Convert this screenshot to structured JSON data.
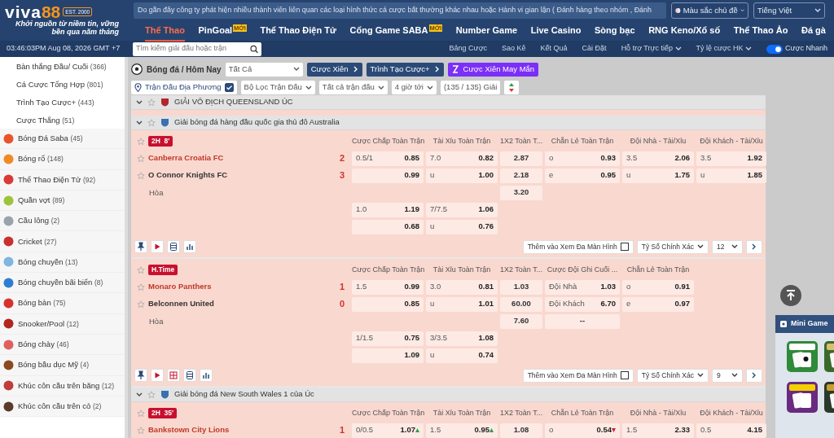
{
  "header": {
    "logo_name": "viva",
    "logo_number": "88",
    "logo_badge": "EST. 2000",
    "slogan": "Khởi nguồn từ niềm tin, vững bền qua năm tháng",
    "notice": "Do gần đây công ty phát hiện nhiều thành viên liên quan các loại hình thức cá cược bất thường khác nhau hoặc Hành vi gian lận ( Đánh hàng theo nhóm , Đánh",
    "theme_select": "Màu sắc chủ đề",
    "language": "Tiếng Việt"
  },
  "nav": [
    {
      "label": "Thể Thao",
      "selected": true
    },
    {
      "label": "PinGoal",
      "badge": "MỚI",
      "selected": false
    },
    {
      "label": "Thể Thao Điện Tử",
      "selected": false
    },
    {
      "label": "Cổng Game SABA",
      "badge": "MỚI",
      "selected": false
    },
    {
      "label": "Number Game",
      "selected": false
    },
    {
      "label": "Live Casino",
      "selected": false
    },
    {
      "label": "Sòng bạc",
      "selected": false
    },
    {
      "label": "RNG Keno/Xổ số",
      "selected": false
    },
    {
      "label": "Thể Thao Ảo",
      "selected": false
    },
    {
      "label": "Đá gà",
      "selected": false
    }
  ],
  "subbar": {
    "clock": "03:46:03PM Aug 08, 2026 GMT +7",
    "search": {
      "placeholder": "Tìm kiếm giải đấu hoặc trận"
    },
    "links": [
      {
        "label": "Bảng Cược",
        "dropdown": false
      },
      {
        "label": "Sao Kê",
        "dropdown": false
      },
      {
        "label": "Kết Quả",
        "dropdown": false
      },
      {
        "label": "Cài Đặt",
        "dropdown": false
      },
      {
        "label": "Hỗ trợ Trực tiếp",
        "dropdown": true
      },
      {
        "label": "Tỷ lệ cược HK",
        "dropdown": true
      }
    ],
    "quick_bet": {
      "label": "Cược Nhanh",
      "on": true
    }
  },
  "sidebar": {
    "bet_types": [
      {
        "label": "Bàn thắng Đầu/ Cuối",
        "count": "(366)"
      },
      {
        "label": "Cá Cược Tổng Hợp",
        "count": "(801)"
      },
      {
        "label": "Trình Tạo Cược+",
        "count": "(443)"
      },
      {
        "label": "Cược Thắng",
        "count": "(51)"
      }
    ],
    "sports": [
      {
        "label": "Bóng Đá Saba",
        "count": "(45)",
        "color": "#e8542c"
      },
      {
        "label": "Bóng rổ",
        "count": "(148)",
        "color": "#f08a24"
      },
      {
        "label": "Thể Thao Điện Tử",
        "count": "(92)",
        "color": "#d93a3a"
      },
      {
        "label": "Quần vợt",
        "count": "(89)",
        "color": "#9cc43a"
      },
      {
        "label": "Cầu lông",
        "count": "(2)",
        "color": "#9aa3ad"
      },
      {
        "label": "Cricket",
        "count": "(27)",
        "color": "#c8312f"
      },
      {
        "label": "Bóng chuyền",
        "count": "(13)",
        "color": "#7fb5e0"
      },
      {
        "label": "Bóng chuyền bãi biển",
        "count": "(8)",
        "color": "#2f7fd0"
      },
      {
        "label": "Bóng bàn",
        "count": "(75)",
        "color": "#d6332f"
      },
      {
        "label": "Snooker/Pool",
        "count": "(12)",
        "color": "#b3261e"
      },
      {
        "label": "Bóng chày",
        "count": "(46)",
        "color": "#e06060"
      },
      {
        "label": "Bóng bầu dục Mỹ",
        "count": "(4)",
        "color": "#8a4a1e"
      },
      {
        "label": "Khúc côn cầu trên băng",
        "count": "(12)",
        "color": "#c23b3b"
      },
      {
        "label": "Khúc côn cầu trên cỏ",
        "count": "(2)",
        "color": "#5a3a2a"
      }
    ]
  },
  "toolbar": {
    "title": "Bóng đá / Hôm Nay",
    "filter": "Tất Cả",
    "buttons": [
      {
        "label": "Cược Xiên",
        "kind": "arrow"
      },
      {
        "label": "Trình Tạo Cược+",
        "kind": "arrow"
      },
      {
        "label": "Cược Xiên May Mắn",
        "kind": "lucky"
      }
    ]
  },
  "filters": [
    {
      "label": "Trận Đấu Địa Phương",
      "kind": "check",
      "checked": true
    },
    {
      "label": "Bộ Lọc Trận Đấu",
      "kind": "dropdown"
    },
    {
      "label": "Tất cả trận đấu",
      "kind": "dropdown"
    },
    {
      "label": "4 giờ tới",
      "kind": "dropdown"
    },
    {
      "label": "(135 / 135) Giải",
      "kind": "plain"
    },
    {
      "kind": "sort"
    }
  ],
  "leagues": [
    {
      "name": "GIẢI VÔ ĐỊCH QUEENSLAND ÚC"
    },
    {
      "name": "Giải bóng đá hàng đầu quốc gia thủ đô Australia",
      "matches": [
        {
          "status": "2H  8'",
          "columns": [
            "Cược Chấp Toàn Trận",
            "Tài Xỉu Toàn Trận",
            "1X2 Toàn T...",
            "Chẵn Lẻ Toàn Trận",
            "Đội Nhà - Tài/Xỉu",
            "Đội Khách - Tài/Xỉu"
          ],
          "teams": [
            {
              "name": "Canberra Croatia FC",
              "score": "2",
              "favorite": true
            },
            {
              "name": "O Connor Knights FC",
              "score": "3",
              "favorite": false
            }
          ],
          "draw_label": "Hòa",
          "rows": [
            [
              {
                "line": "0.5/1",
                "odds": "0.85"
              },
              {
                "line": "7.0",
                "odds": "0.82"
              },
              {
                "text": "2.87"
              },
              {
                "line": "o",
                "odds": "0.93"
              },
              {
                "line": "3.5",
                "odds": "2.06"
              },
              {
                "line": "3.5",
                "odds": "1.92"
              }
            ],
            [
              {
                "odds": "0.99"
              },
              {
                "line": "u",
                "odds": "1.00"
              },
              {
                "text": "2.18"
              },
              {
                "line": "e",
                "odds": "0.95"
              },
              {
                "line": "u",
                "odds": "1.75"
              },
              {
                "line": "u",
                "odds": "1.85"
              }
            ],
            [
              null,
              null,
              {
                "text": "3.20"
              },
              null,
              null,
              null
            ],
            [
              {
                "line": "1.0",
                "odds": "1.19"
              },
              {
                "line": "7/7.5",
                "odds": "1.06"
              },
              null,
              null,
              null,
              null
            ],
            [
              {
                "odds": "0.68"
              },
              {
                "line": "u",
                "odds": "0.76"
              },
              null,
              null,
              null,
              null
            ]
          ],
          "tools": [
            {
              "kind": "pin"
            },
            {
              "kind": "play"
            },
            {
              "kind": "list"
            },
            {
              "kind": "chart"
            }
          ],
          "multi_view": {
            "label": "Thêm vào Xem Đa Màn Hình",
            "checked": false
          },
          "market_select": "Tỷ Số Chính Xác",
          "count_select": "12"
        },
        {
          "status": "H.Time",
          "columns": [
            "Cược Chấp Toàn Trận",
            "Tài Xỉu Toàn Trận",
            "1X2 Toàn T...",
            "Cược Đội Ghi Cuối ...",
            "Chẵn Lẻ Toàn Trận"
          ],
          "teams": [
            {
              "name": "Monaro Panthers",
              "score": "1",
              "favorite": true
            },
            {
              "name": "Belconnen United",
              "score": "0",
              "favorite": false
            }
          ],
          "draw_label": "Hòa",
          "rows": [
            [
              {
                "line": "1.5",
                "odds": "0.99"
              },
              {
                "line": "3.0",
                "odds": "0.81"
              },
              {
                "text": "1.03"
              },
              {
                "line": "Đội Nhà",
                "odds": "1.03"
              },
              {
                "line": "o",
                "odds": "0.91"
              }
            ],
            [
              {
                "odds": "0.85"
              },
              {
                "line": "u",
                "odds": "1.01"
              },
              {
                "text": "60.00"
              },
              {
                "line": "Đội Khách",
                "odds": "6.70"
              },
              {
                "line": "e",
                "odds": "0.97"
              }
            ],
            [
              null,
              null,
              {
                "text": "7.60"
              },
              {
                "text": "--"
              },
              null
            ],
            [
              {
                "line": "1/1.5",
                "odds": "0.75"
              },
              {
                "line": "3/3.5",
                "odds": "1.08"
              },
              null,
              null,
              null
            ],
            [
              {
                "odds": "1.09"
              },
              {
                "line": "u",
                "odds": "0.74"
              },
              null,
              null,
              null
            ]
          ],
          "tools": [
            {
              "kind": "pin"
            },
            {
              "kind": "play"
            },
            {
              "kind": "grid"
            },
            {
              "kind": "list"
            },
            {
              "kind": "chart"
            }
          ],
          "multi_view": {
            "label": "Thêm vào Xem Đa Màn Hình",
            "checked": false
          },
          "market_select": "Tỷ Số Chính Xác",
          "count_select": "9"
        }
      ]
    },
    {
      "name": "Giải bóng đá New South Wales 1 của Úc",
      "matches": [
        {
          "status": "2H  35'",
          "columns": [
            "Cược Chấp Toàn Trận",
            "Tài Xỉu Toàn Trận",
            "1X2 Toàn T...",
            "Chẵn Lẻ Toàn Trận",
            "Đội Nhà - Tài/Xỉu",
            "Đội Khách - Tài/Xỉu"
          ],
          "teams": [
            {
              "name": "Bankstown City Lions",
              "score": "1",
              "favorite": true
            }
          ],
          "rows": [
            [
              {
                "line": "0/0.5",
                "odds": "1.07",
                "rising": true
              },
              {
                "line": "1.5",
                "odds": "0.95",
                "rising": true
              },
              {
                "text": "1.08"
              },
              {
                "line": "o",
                "odds": "0.54",
                "rising": false
              },
              {
                "line": "1.5",
                "odds": "2.33"
              },
              {
                "line": "0.5",
                "odds": "4.15"
              }
            ]
          ]
        }
      ]
    }
  ],
  "mini_games": {
    "title": "Mini Game"
  }
}
